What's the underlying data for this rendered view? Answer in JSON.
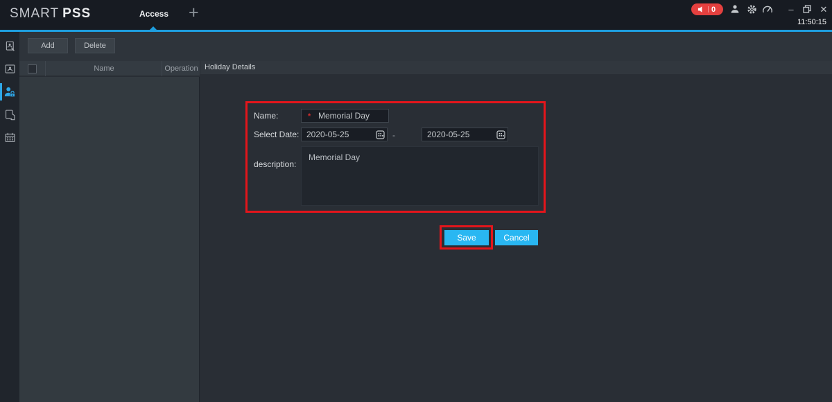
{
  "app": {
    "logo_primary": "SMART",
    "logo_secondary": "PSS",
    "clock": "11:50:15"
  },
  "topbar": {
    "active_tab": "Access",
    "new_tab_glyph": "+",
    "notification_count": "0",
    "minimize_glyph": "–",
    "close_glyph": "✕"
  },
  "toolbar": {
    "add_label": "Add",
    "delete_label": "Delete"
  },
  "holiday_table": {
    "columns": {
      "name": "Name",
      "operation": "Operation"
    },
    "rows": []
  },
  "panel": {
    "title": "Holiday Details"
  },
  "form": {
    "name_label": "Name:",
    "required_marker": "*",
    "name_value": "Memorial Day",
    "date_label": "Select Date:",
    "date_start": "2020-05-25",
    "date_range_separator": "-",
    "date_end": "2020-05-25",
    "description_label": "description:",
    "description_value": "Memorial Day"
  },
  "actions": {
    "save_label": "Save",
    "cancel_label": "Cancel"
  },
  "colors": {
    "accent_blue": "#1e9ede",
    "active_icon_blue": "#2ea7e8",
    "button_cyan": "#29b7f2",
    "highlight_red": "#e4151b",
    "notification_red": "#e4403f"
  }
}
